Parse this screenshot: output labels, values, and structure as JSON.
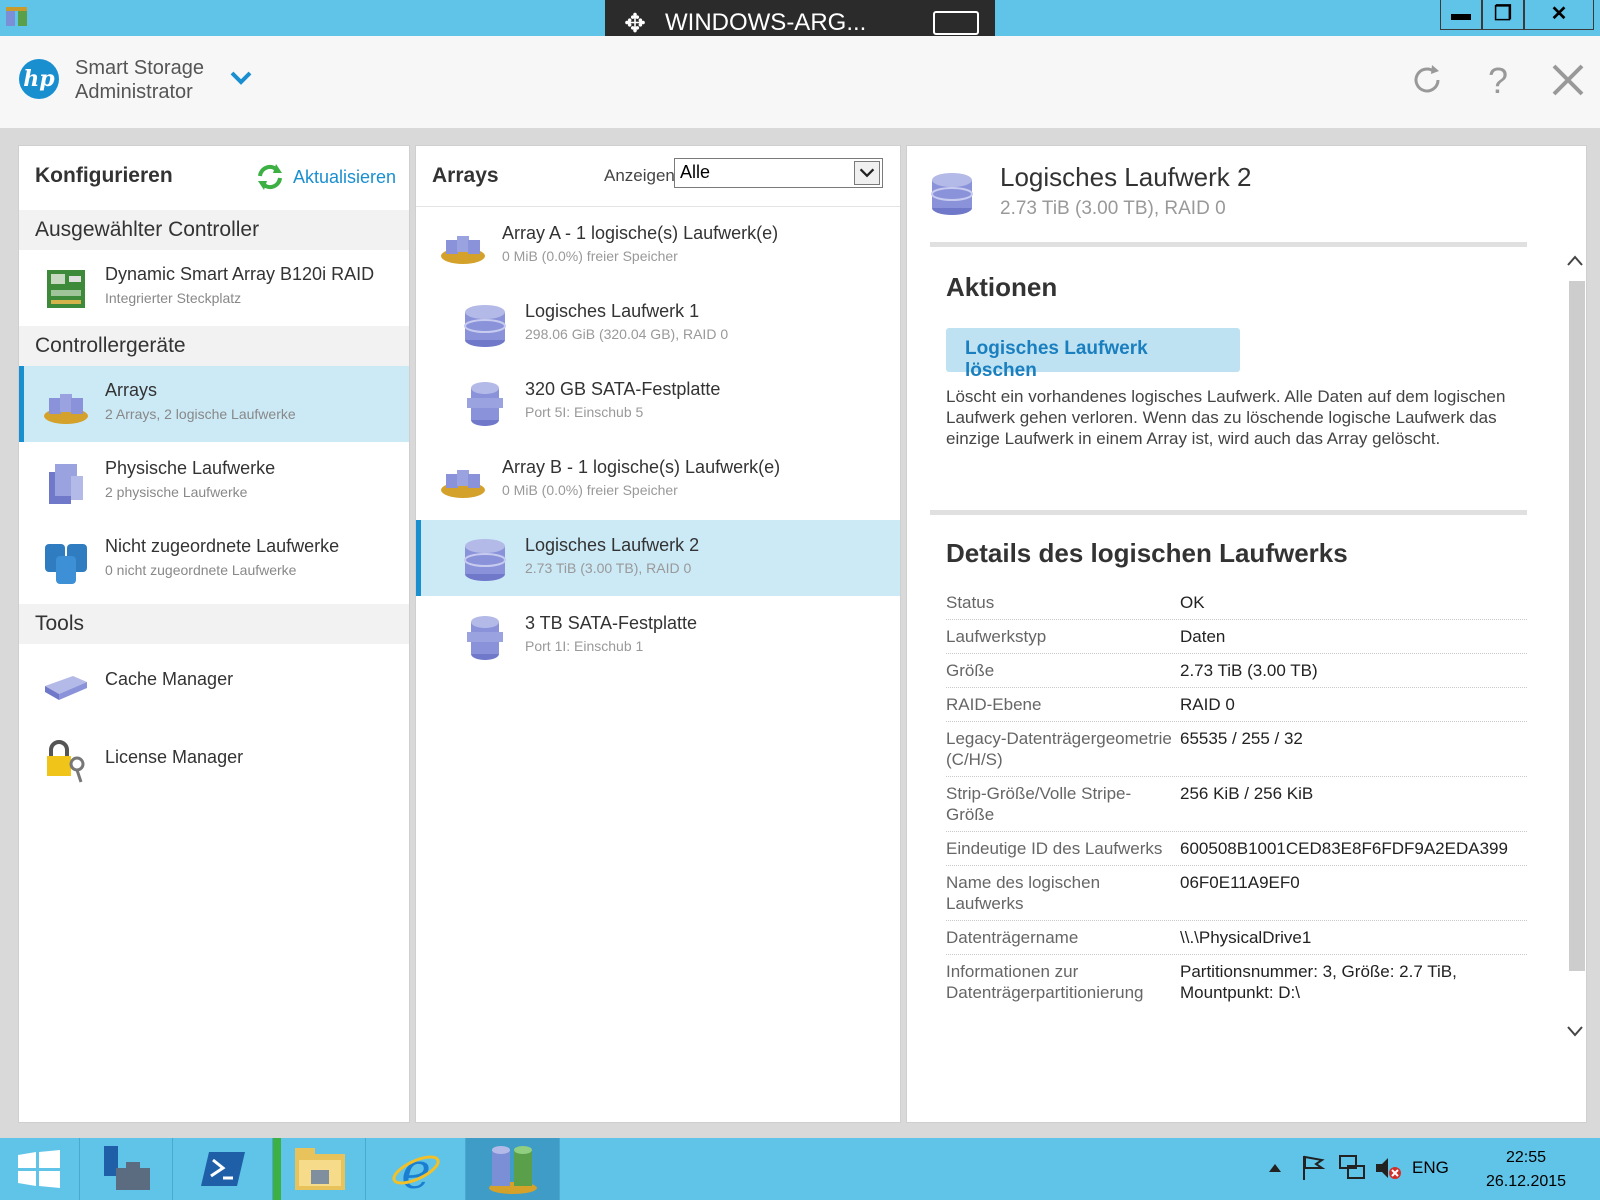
{
  "window": {
    "remote_title": "WINDOWS-ARG...",
    "minimize_glyph": "▬",
    "restore_glyph": "❐",
    "close_glyph": "✕"
  },
  "app": {
    "logo_text": "hp",
    "title_line1": "Smart Storage",
    "title_line2": "Administrator"
  },
  "left": {
    "title": "Konfigurieren",
    "refresh_label": "Aktualisieren",
    "sections": {
      "controller": "Ausgewählter Controller",
      "devices": "Controllergeräte",
      "tools": "Tools"
    },
    "controller": {
      "name": "Dynamic Smart Array B120i RAID",
      "sub": "Integrierter Steckplatz"
    },
    "devices": [
      {
        "name": "Arrays",
        "sub": "2 Arrays, 2 logische Laufwerke"
      },
      {
        "name": "Physische Laufwerke",
        "sub": "2 physische Laufwerke"
      },
      {
        "name": "Nicht zugeordnete Laufwerke",
        "sub": "0 nicht zugeordnete Laufwerke"
      }
    ],
    "tools": [
      {
        "name": "Cache Manager"
      },
      {
        "name": "License Manager"
      }
    ]
  },
  "middle": {
    "title": "Arrays",
    "show_label": "Anzeigen",
    "show_value": "Alle",
    "items": [
      {
        "name": "Array A - 1 logische(s) Laufwerk(e)",
        "sub": "0 MiB (0.0%) freier Speicher"
      },
      {
        "name": "Logisches Laufwerk 1",
        "sub": "298.06 GiB (320.04 GB), RAID 0"
      },
      {
        "name": "320 GB SATA-Festplatte",
        "sub": "Port 5I: Einschub 5"
      },
      {
        "name": "Array B - 1 logische(s) Laufwerk(e)",
        "sub": "0 MiB (0.0%) freier Speicher"
      },
      {
        "name": "Logisches Laufwerk 2",
        "sub": "2.73 TiB (3.00 TB), RAID 0"
      },
      {
        "name": "3 TB SATA-Festplatte",
        "sub": "Port 1I: Einschub 1"
      }
    ]
  },
  "right": {
    "title": "Logisches Laufwerk 2",
    "subtitle": "2.73 TiB (3.00 TB), RAID 0",
    "actions_heading": "Aktionen",
    "action_button": "Logisches Laufwerk löschen",
    "action_desc": "Löscht ein vorhandenes logisches Laufwerk. Alle Daten auf dem logischen Laufwerk gehen verloren. Wenn das zu löschende logische Laufwerk das einzige Laufwerk in einem Array ist, wird auch das Array gelöscht.",
    "details_heading": "Details des logischen Laufwerks",
    "details": [
      {
        "key": "Status",
        "value": "OK"
      },
      {
        "key": "Laufwerkstyp",
        "value": "Daten"
      },
      {
        "key": "Größe",
        "value": "2.73 TiB (3.00 TB)"
      },
      {
        "key": "RAID-Ebene",
        "value": "RAID 0"
      },
      {
        "key": "Legacy-Datenträgergeometrie (C/H/S)",
        "value": "65535 / 255 / 32"
      },
      {
        "key": "Strip-Größe/Volle Stripe-Größe",
        "value": "256 KiB / 256 KiB"
      },
      {
        "key": "Eindeutige ID des Laufwerks",
        "value": "600508B1001CED83E8F6FDF9A2EDA399"
      },
      {
        "key": "Name des logischen Laufwerks",
        "value": "06F0E11A9EF0"
      },
      {
        "key": "Datenträgername",
        "value": "\\\\.\\PhysicalDrive1"
      },
      {
        "key": "Informationen zur Datenträgerpartitionierung",
        "value": "Partitionsnummer: 3, Größe: 2.7 TiB, Mountpunkt: D:\\"
      }
    ]
  },
  "taskbar": {
    "lang": "ENG",
    "time": "22:55",
    "date": "26.12.2015"
  },
  "colors": {
    "accent": "#1a8fd0",
    "selection": "#cce9f6",
    "titlebar": "#5fc4e8"
  }
}
